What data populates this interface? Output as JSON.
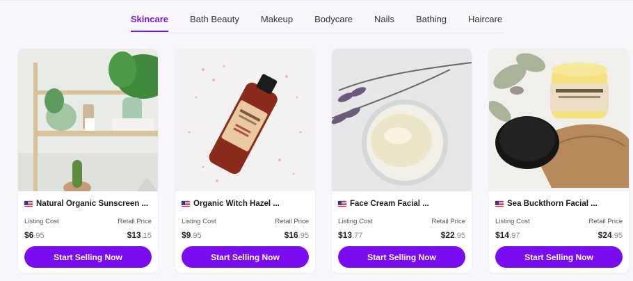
{
  "tabs": [
    {
      "label": "Skincare",
      "active": true
    },
    {
      "label": "Bath Beauty",
      "active": false
    },
    {
      "label": "Makeup",
      "active": false
    },
    {
      "label": "Bodycare",
      "active": false
    },
    {
      "label": "Nails",
      "active": false
    },
    {
      "label": "Bathing",
      "active": false
    },
    {
      "label": "Haircare",
      "active": false
    }
  ],
  "colors": {
    "accent": "#7b18e2",
    "button": "#7a0cf2"
  },
  "products": [
    {
      "title": "Natural Organic Sunscreen ...",
      "listing_label": "Listing Cost",
      "listing_dollars": "$6",
      "listing_cents": ".95",
      "retail_label": "Retail Price",
      "retail_dollars": "$13",
      "retail_cents": ".15",
      "button_label": "Start Selling Now"
    },
    {
      "title": "Organic Witch Hazel ...",
      "listing_label": "Listing Cost",
      "listing_dollars": "$9",
      "listing_cents": ".95",
      "retail_label": "Retail Price",
      "retail_dollars": "$16",
      "retail_cents": ".95",
      "button_label": "Start Selling Now"
    },
    {
      "title": "Face Cream Facial ...",
      "listing_label": "Listing Cost",
      "listing_dollars": "$13",
      "listing_cents": ".77",
      "retail_label": "Retail Price",
      "retail_dollars": "$22",
      "retail_cents": ".95",
      "button_label": "Start Selling Now"
    },
    {
      "title": "Sea Buckthorn Facial ...",
      "listing_label": "Listing Cost",
      "listing_dollars": "$14",
      "listing_cents": ".97",
      "retail_label": "Retail Price",
      "retail_dollars": "$24",
      "retail_cents": ".95",
      "button_label": "Start Selling Now"
    }
  ]
}
